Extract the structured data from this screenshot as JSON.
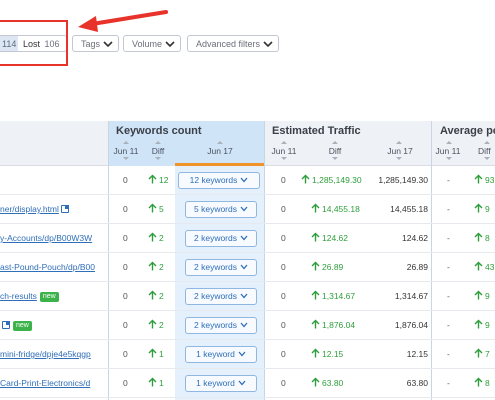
{
  "filters": {
    "segment_a_value": "114",
    "lost_label": "Lost",
    "lost_count": "106",
    "tags_label": "Tags",
    "volume_label": "Volume",
    "advanced_label": "Advanced filters"
  },
  "annotation": {
    "highlight_color": "#e8332a"
  },
  "table": {
    "groups": {
      "keywords_count": "Keywords count",
      "estimated_traffic": "Estimated Traffic",
      "average_pos": "Average po"
    },
    "columns": {
      "kw_jun11": "Jun 11",
      "kw_diff": "Diff",
      "kw_jun17": "Jun 17",
      "tr_jun11": "Jun 11",
      "tr_diff": "Diff",
      "tr_jun17": "Jun 17",
      "ap_jun11": "Jun 11",
      "ap_diff": "Diff"
    },
    "rows": [
      {
        "url": "",
        "ext": false,
        "new": false,
        "kw_jun11": "0",
        "kw_diff": "12",
        "kw_btn": "12 keywords",
        "tr_jun11": "0",
        "tr_diff": "1,285,149.30",
        "tr_jun17": "1,285,149.30",
        "ap_jun11": "-",
        "ap_diff": "93"
      },
      {
        "url": "ner/display.html",
        "ext": true,
        "new": false,
        "kw_jun11": "0",
        "kw_diff": "5",
        "kw_btn": "5 keywords",
        "tr_jun11": "0",
        "tr_diff": "14,455.18",
        "tr_jun17": "14,455.18",
        "ap_jun11": "-",
        "ap_diff": "9"
      },
      {
        "url": "y-Accounts/dp/B00W3W",
        "ext": false,
        "new": false,
        "kw_jun11": "0",
        "kw_diff": "2",
        "kw_btn": "2 keywords",
        "tr_jun11": "0",
        "tr_diff": "124.62",
        "tr_jun17": "124.62",
        "ap_jun11": "-",
        "ap_diff": "8"
      },
      {
        "url": "ast-Pound-Pouch/dp/B00",
        "ext": false,
        "new": false,
        "kw_jun11": "0",
        "kw_diff": "2",
        "kw_btn": "2 keywords",
        "tr_jun11": "0",
        "tr_diff": "26.89",
        "tr_jun17": "26.89",
        "ap_jun11": "-",
        "ap_diff": "43"
      },
      {
        "url": "ch-results",
        "ext": false,
        "new": true,
        "kw_jun11": "0",
        "kw_diff": "2",
        "kw_btn": "2 keywords",
        "tr_jun11": "0",
        "tr_diff": "1,314.67",
        "tr_jun17": "1,314.67",
        "ap_jun11": "-",
        "ap_diff": "9"
      },
      {
        "url": "",
        "ext": true,
        "new": true,
        "kw_jun11": "0",
        "kw_diff": "2",
        "kw_btn": "2 keywords",
        "tr_jun11": "0",
        "tr_diff": "1,876.04",
        "tr_jun17": "1,876.04",
        "ap_jun11": "-",
        "ap_diff": "9"
      },
      {
        "url": "mini-fridge/dpje4e5kqgp",
        "ext": false,
        "new": false,
        "kw_jun11": "0",
        "kw_diff": "1",
        "kw_btn": "1 keyword",
        "tr_jun11": "0",
        "tr_diff": "12.15",
        "tr_jun17": "12.15",
        "ap_jun11": "-",
        "ap_diff": "7"
      },
      {
        "url": "Card-Print-Electronics/d",
        "ext": false,
        "new": false,
        "kw_jun11": "0",
        "kw_diff": "1",
        "kw_btn": "1 keyword",
        "tr_jun11": "0",
        "tr_diff": "63.80",
        "tr_jun17": "63.80",
        "ap_jun11": "-",
        "ap_diff": "8"
      }
    ],
    "new_badge": "new"
  }
}
